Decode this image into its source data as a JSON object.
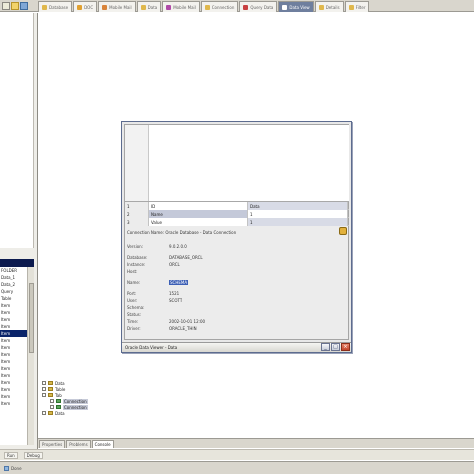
{
  "toolbar": {
    "icons": [
      "new-icon",
      "folder-icon",
      "save-icon"
    ]
  },
  "tabs": [
    {
      "label": "Database",
      "color": "#e0b84c",
      "active": false
    },
    {
      "label": "DOC",
      "color": "#e0a030",
      "active": false
    },
    {
      "label": "Mobile Mail",
      "color": "#d9843a",
      "active": false
    },
    {
      "label": "Data",
      "color": "#e0b84c",
      "active": false
    },
    {
      "label": "Mobile Mail",
      "color": "#b04aa8",
      "active": false
    },
    {
      "label": "Connection",
      "color": "#e0b84c",
      "active": false
    },
    {
      "label": "Query Data",
      "color": "#c84040",
      "active": false
    },
    {
      "label": "Data View",
      "color": "#ffffff",
      "active": true
    },
    {
      "label": "Details",
      "color": "#e0b84c",
      "active": false
    },
    {
      "label": "Filter",
      "color": "#e0b84c",
      "active": false
    }
  ],
  "left_tree": {
    "items": [
      {
        "label": "FOLDER",
        "selected": false
      },
      {
        "label": "Data_1",
        "selected": false
      },
      {
        "label": "Data_2",
        "selected": false
      },
      {
        "label": "Query",
        "selected": false
      },
      {
        "label": "Table",
        "selected": false
      },
      {
        "label": "Item",
        "selected": false
      },
      {
        "label": "Item",
        "selected": false
      },
      {
        "label": "Item",
        "selected": false
      },
      {
        "label": "Item",
        "selected": false
      },
      {
        "label": "Item",
        "selected": true
      },
      {
        "label": "Item",
        "selected": false
      },
      {
        "label": "Item",
        "selected": false
      },
      {
        "label": "Item",
        "selected": false
      },
      {
        "label": "Item",
        "selected": false
      },
      {
        "label": "Item",
        "selected": false
      },
      {
        "label": "Item",
        "selected": false
      },
      {
        "label": "Item",
        "selected": false
      },
      {
        "label": "Item",
        "selected": false
      },
      {
        "label": "Item",
        "selected": false
      },
      {
        "label": "Item",
        "selected": false
      }
    ]
  },
  "bottom_tree": {
    "items": [
      {
        "label": "Data",
        "icon": "folder",
        "highlight": false,
        "indent": 0
      },
      {
        "label": "Table",
        "icon": "folder",
        "highlight": false,
        "indent": 0
      },
      {
        "label": "Tab",
        "icon": "folder",
        "highlight": false,
        "indent": 0
      },
      {
        "label": "Connection",
        "icon": "green",
        "highlight": true,
        "indent": 1
      },
      {
        "label": "Connection",
        "icon": "green",
        "highlight": true,
        "indent": 1
      },
      {
        "label": "Data",
        "icon": "folder",
        "highlight": false,
        "indent": 0
      }
    ]
  },
  "bottom_tabs": [
    {
      "label": "Properties",
      "active": false
    },
    {
      "label": "Problems",
      "active": false
    },
    {
      "label": "Console",
      "active": true
    }
  ],
  "bottom_toolbar": {
    "buttons": [
      "Run",
      "Debug"
    ]
  },
  "status": {
    "text": "Done"
  },
  "dialog": {
    "grid": [
      [
        "1",
        "ID",
        "Data"
      ],
      [
        "2",
        "Name",
        "1"
      ],
      [
        "3",
        "Value",
        "1"
      ]
    ],
    "header_text": "Connection Name: Oracle Database - Data Connection",
    "properties": [
      {
        "label": "Version:",
        "value": "9.0.2.0.0"
      },
      {
        "label": "",
        "value": ""
      },
      {
        "label": "Database:",
        "value": "DATABASE_ORCL"
      },
      {
        "label": "Instance:",
        "value": "ORCL"
      },
      {
        "label": "Host:",
        "value": ""
      },
      {
        "label": "",
        "value": ""
      },
      {
        "label": "Name:",
        "value": "SCHEMA",
        "link": true
      },
      {
        "label": "",
        "value": ""
      },
      {
        "label": "Port:",
        "value": "1521"
      },
      {
        "label": "User:",
        "value": "SCOTT"
      },
      {
        "label": "Schema:",
        "value": ""
      },
      {
        "label": "Status:",
        "value": ""
      },
      {
        "label": "Time:",
        "value": "2002-10-01 12:00"
      },
      {
        "label": "Driver:",
        "value": "ORACLE_THIN"
      }
    ],
    "title": "Oracle Data Viewer - Data",
    "buttons": [
      "minimize-button",
      "maximize-button",
      "close-button"
    ]
  }
}
